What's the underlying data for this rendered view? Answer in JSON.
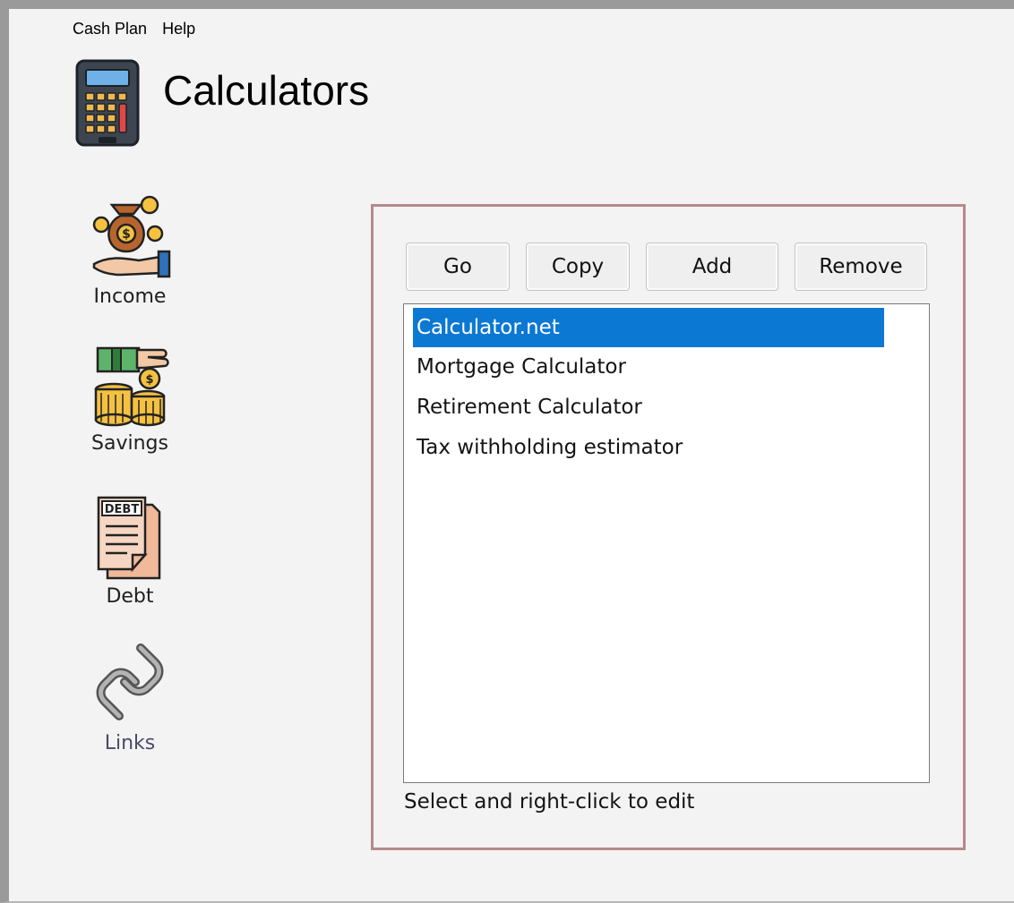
{
  "menu": {
    "items": [
      "Cash Plan",
      "Help"
    ]
  },
  "header": {
    "title": "Calculators",
    "icon": "calculator-icon"
  },
  "nav": {
    "items": [
      {
        "label": "Income",
        "icon": "money-bag-hand-icon"
      },
      {
        "label": "Savings",
        "icon": "coins-cash-icon"
      },
      {
        "label": "Debt",
        "icon": "debt-document-icon",
        "icon_text": "DEBT"
      },
      {
        "label": "Links",
        "icon": "chain-link-icon",
        "active": true
      }
    ]
  },
  "toolbar": {
    "go_label": "Go",
    "copy_label": "Copy",
    "add_label": "Add",
    "remove_label": "Remove"
  },
  "list": {
    "items": [
      {
        "label": "Calculator.net",
        "selected": true
      },
      {
        "label": "Mortgage Calculator",
        "selected": false
      },
      {
        "label": "Retirement Calculator",
        "selected": false
      },
      {
        "label": "Tax withholding estimator",
        "selected": false
      }
    ]
  },
  "hint": "Select and right-click to edit",
  "colors": {
    "selection": "#0b78d4",
    "panel_border": "#b6898c",
    "window_bg": "#f3f3f3"
  }
}
